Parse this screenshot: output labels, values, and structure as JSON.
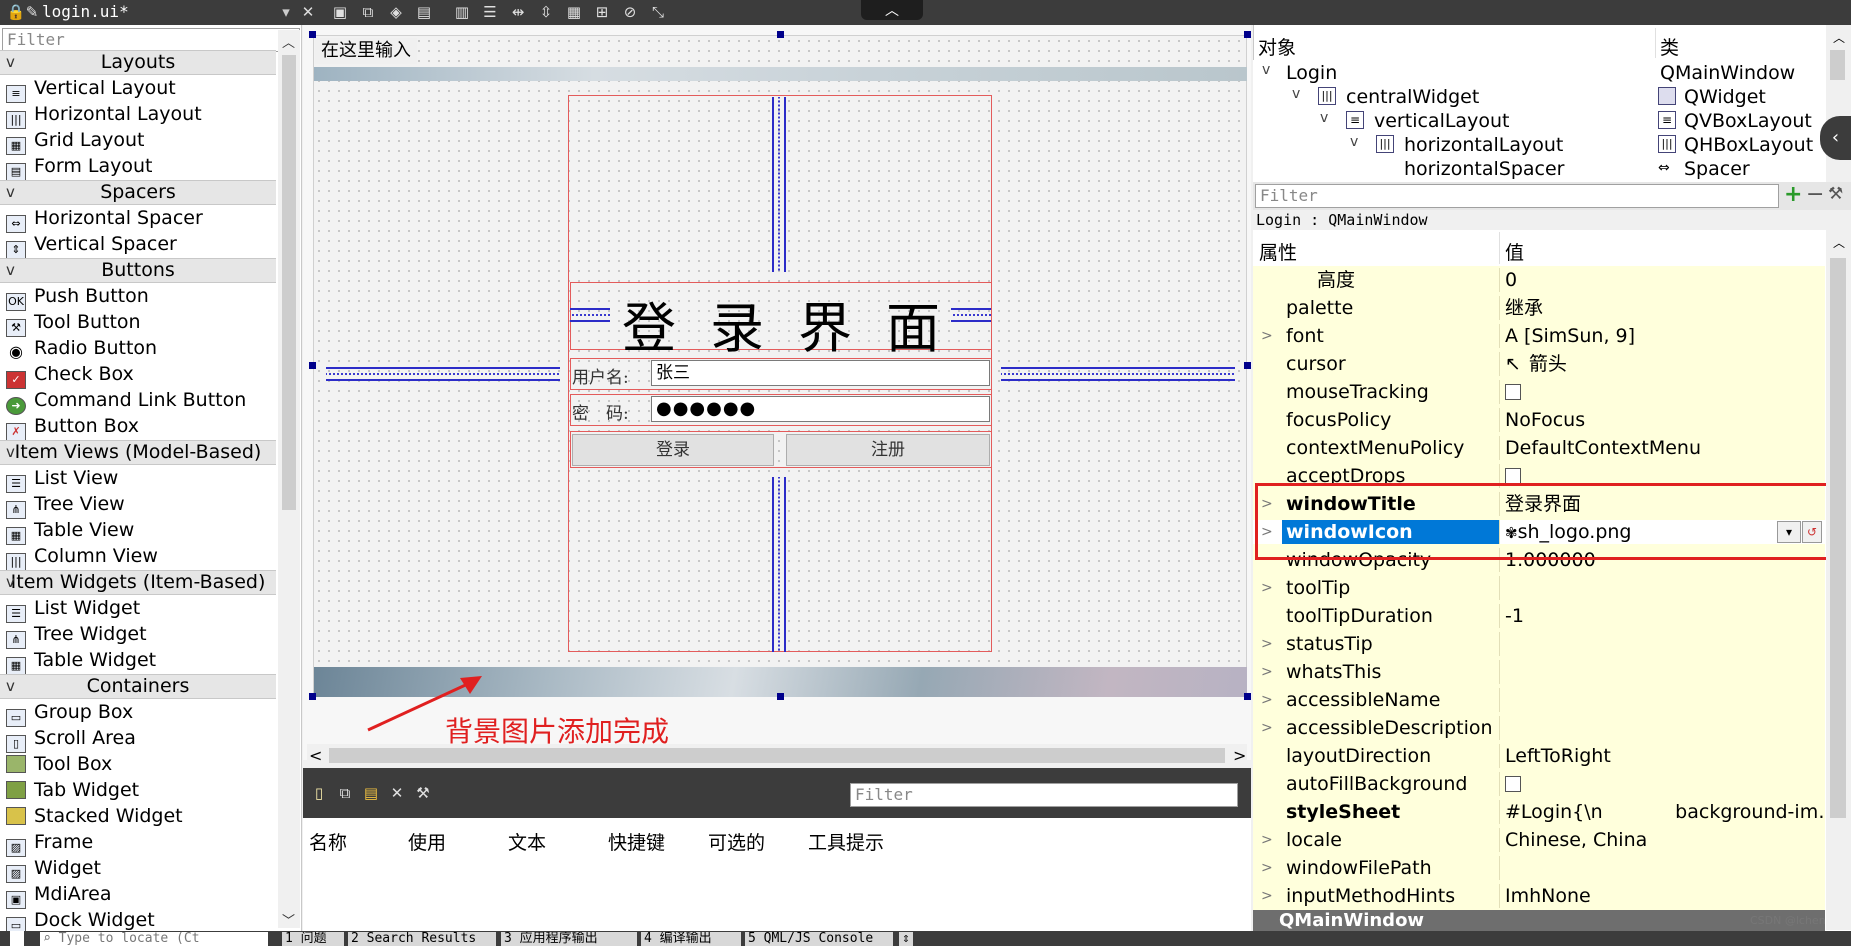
{
  "toolbar": {
    "file_name": "login.ui*",
    "collapse_glyph": "︿"
  },
  "widget_box": {
    "filter_placeholder": "Filter",
    "categories": {
      "layouts": "Layouts",
      "spacers": "Spacers",
      "buttons": "Buttons",
      "item_views": "Item Views (Model-Based)",
      "item_widgets": "Item Widgets (Item-Based)",
      "containers": "Containers"
    },
    "items": {
      "vertical_layout": "Vertical Layout",
      "horizontal_layout": "Horizontal Layout",
      "grid_layout": "Grid Layout",
      "form_layout": "Form Layout",
      "horizontal_spacer": "Horizontal Spacer",
      "vertical_spacer": "Vertical Spacer",
      "push_button": "Push Button",
      "tool_button": "Tool Button",
      "radio_button": "Radio Button",
      "check_box": "Check Box",
      "command_link_button": "Command Link Button",
      "button_box": "Button Box",
      "list_view": "List View",
      "tree_view": "Tree View",
      "table_view": "Table View",
      "column_view": "Column View",
      "list_widget": "List Widget",
      "tree_widget": "Tree Widget",
      "table_widget": "Table Widget",
      "group_box": "Group Box",
      "scroll_area": "Scroll Area",
      "tool_box": "Tool Box",
      "tab_widget": "Tab Widget",
      "stacked_widget": "Stacked Widget",
      "frame": "Frame",
      "widget": "Widget",
      "mdi_area": "MdiArea",
      "dock_widget": "Dock Widget"
    }
  },
  "form": {
    "menubar_placeholder": "在这里输入",
    "title": "登录界面",
    "username_label": "用户名:",
    "username_value": "张三",
    "password_label": "密　码:",
    "password_value": "●●●●●●",
    "login_button": "登录",
    "register_button": "注册"
  },
  "annotation": "背景图片添加完成",
  "action_editor": {
    "filter_placeholder": "Filter",
    "columns": [
      "名称",
      "使用",
      "文本",
      "快捷键",
      "可选的",
      "工具提示"
    ]
  },
  "object_inspector": {
    "col_object": "对象",
    "col_class": "类",
    "rows": [
      {
        "name": "Login",
        "class": "QMainWindow"
      },
      {
        "name": "centralWidget",
        "class": "QWidget"
      },
      {
        "name": "verticalLayout",
        "class": "QVBoxLayout"
      },
      {
        "name": "horizontalLayout",
        "class": "QHBoxLayout"
      },
      {
        "name": "horizontalSpacer",
        "class": "Spacer"
      }
    ]
  },
  "property_editor": {
    "filter_placeholder": "Filter",
    "context": "Login : QMainWindow",
    "col_property": "属性",
    "col_value": "值",
    "rows": [
      {
        "name": "高度",
        "value": "0"
      },
      {
        "name": "palette",
        "value": "继承"
      },
      {
        "name": "font",
        "value": "A  [SimSun, 9]"
      },
      {
        "name": "cursor",
        "value": "箭头"
      },
      {
        "name": "mouseTracking",
        "value": ""
      },
      {
        "name": "focusPolicy",
        "value": "NoFocus"
      },
      {
        "name": "contextMenuPolicy",
        "value": "DefaultContextMenu"
      },
      {
        "name": "acceptDrops",
        "value": ""
      },
      {
        "name": "windowTitle",
        "value": "登录界面"
      },
      {
        "name": "windowIcon",
        "value": "sh_logo.png"
      },
      {
        "name": "windowOpacity",
        "value": "1.000000"
      },
      {
        "name": "toolTip",
        "value": ""
      },
      {
        "name": "toolTipDuration",
        "value": "-1"
      },
      {
        "name": "statusTip",
        "value": ""
      },
      {
        "name": "whatsThis",
        "value": ""
      },
      {
        "name": "accessibleName",
        "value": ""
      },
      {
        "name": "accessibleDescription",
        "value": ""
      },
      {
        "name": "layoutDirection",
        "value": "LeftToRight"
      },
      {
        "name": "autoFillBackground",
        "value": ""
      },
      {
        "name": "styleSheet",
        "value": "#Login{\\n            background-im…"
      },
      {
        "name": "locale",
        "value": "Chinese, China"
      },
      {
        "name": "windowFilePath",
        "value": ""
      },
      {
        "name": "inputMethodHints",
        "value": "ImhNone"
      }
    ],
    "section": "QMainWindow"
  },
  "status_bar": {
    "locate_placeholder": "Type to locate (Ct",
    "tabs": [
      "1 问题",
      "2 Search Results",
      "3 应用程序输出",
      "4 编译输出",
      "5 QML/JS Console"
    ]
  },
  "watermark": "CSDN @lchen",
  "colors": {
    "highlight": "#0078d7",
    "property_row_bg": "#ffffdc",
    "annotation": "#e02020"
  }
}
